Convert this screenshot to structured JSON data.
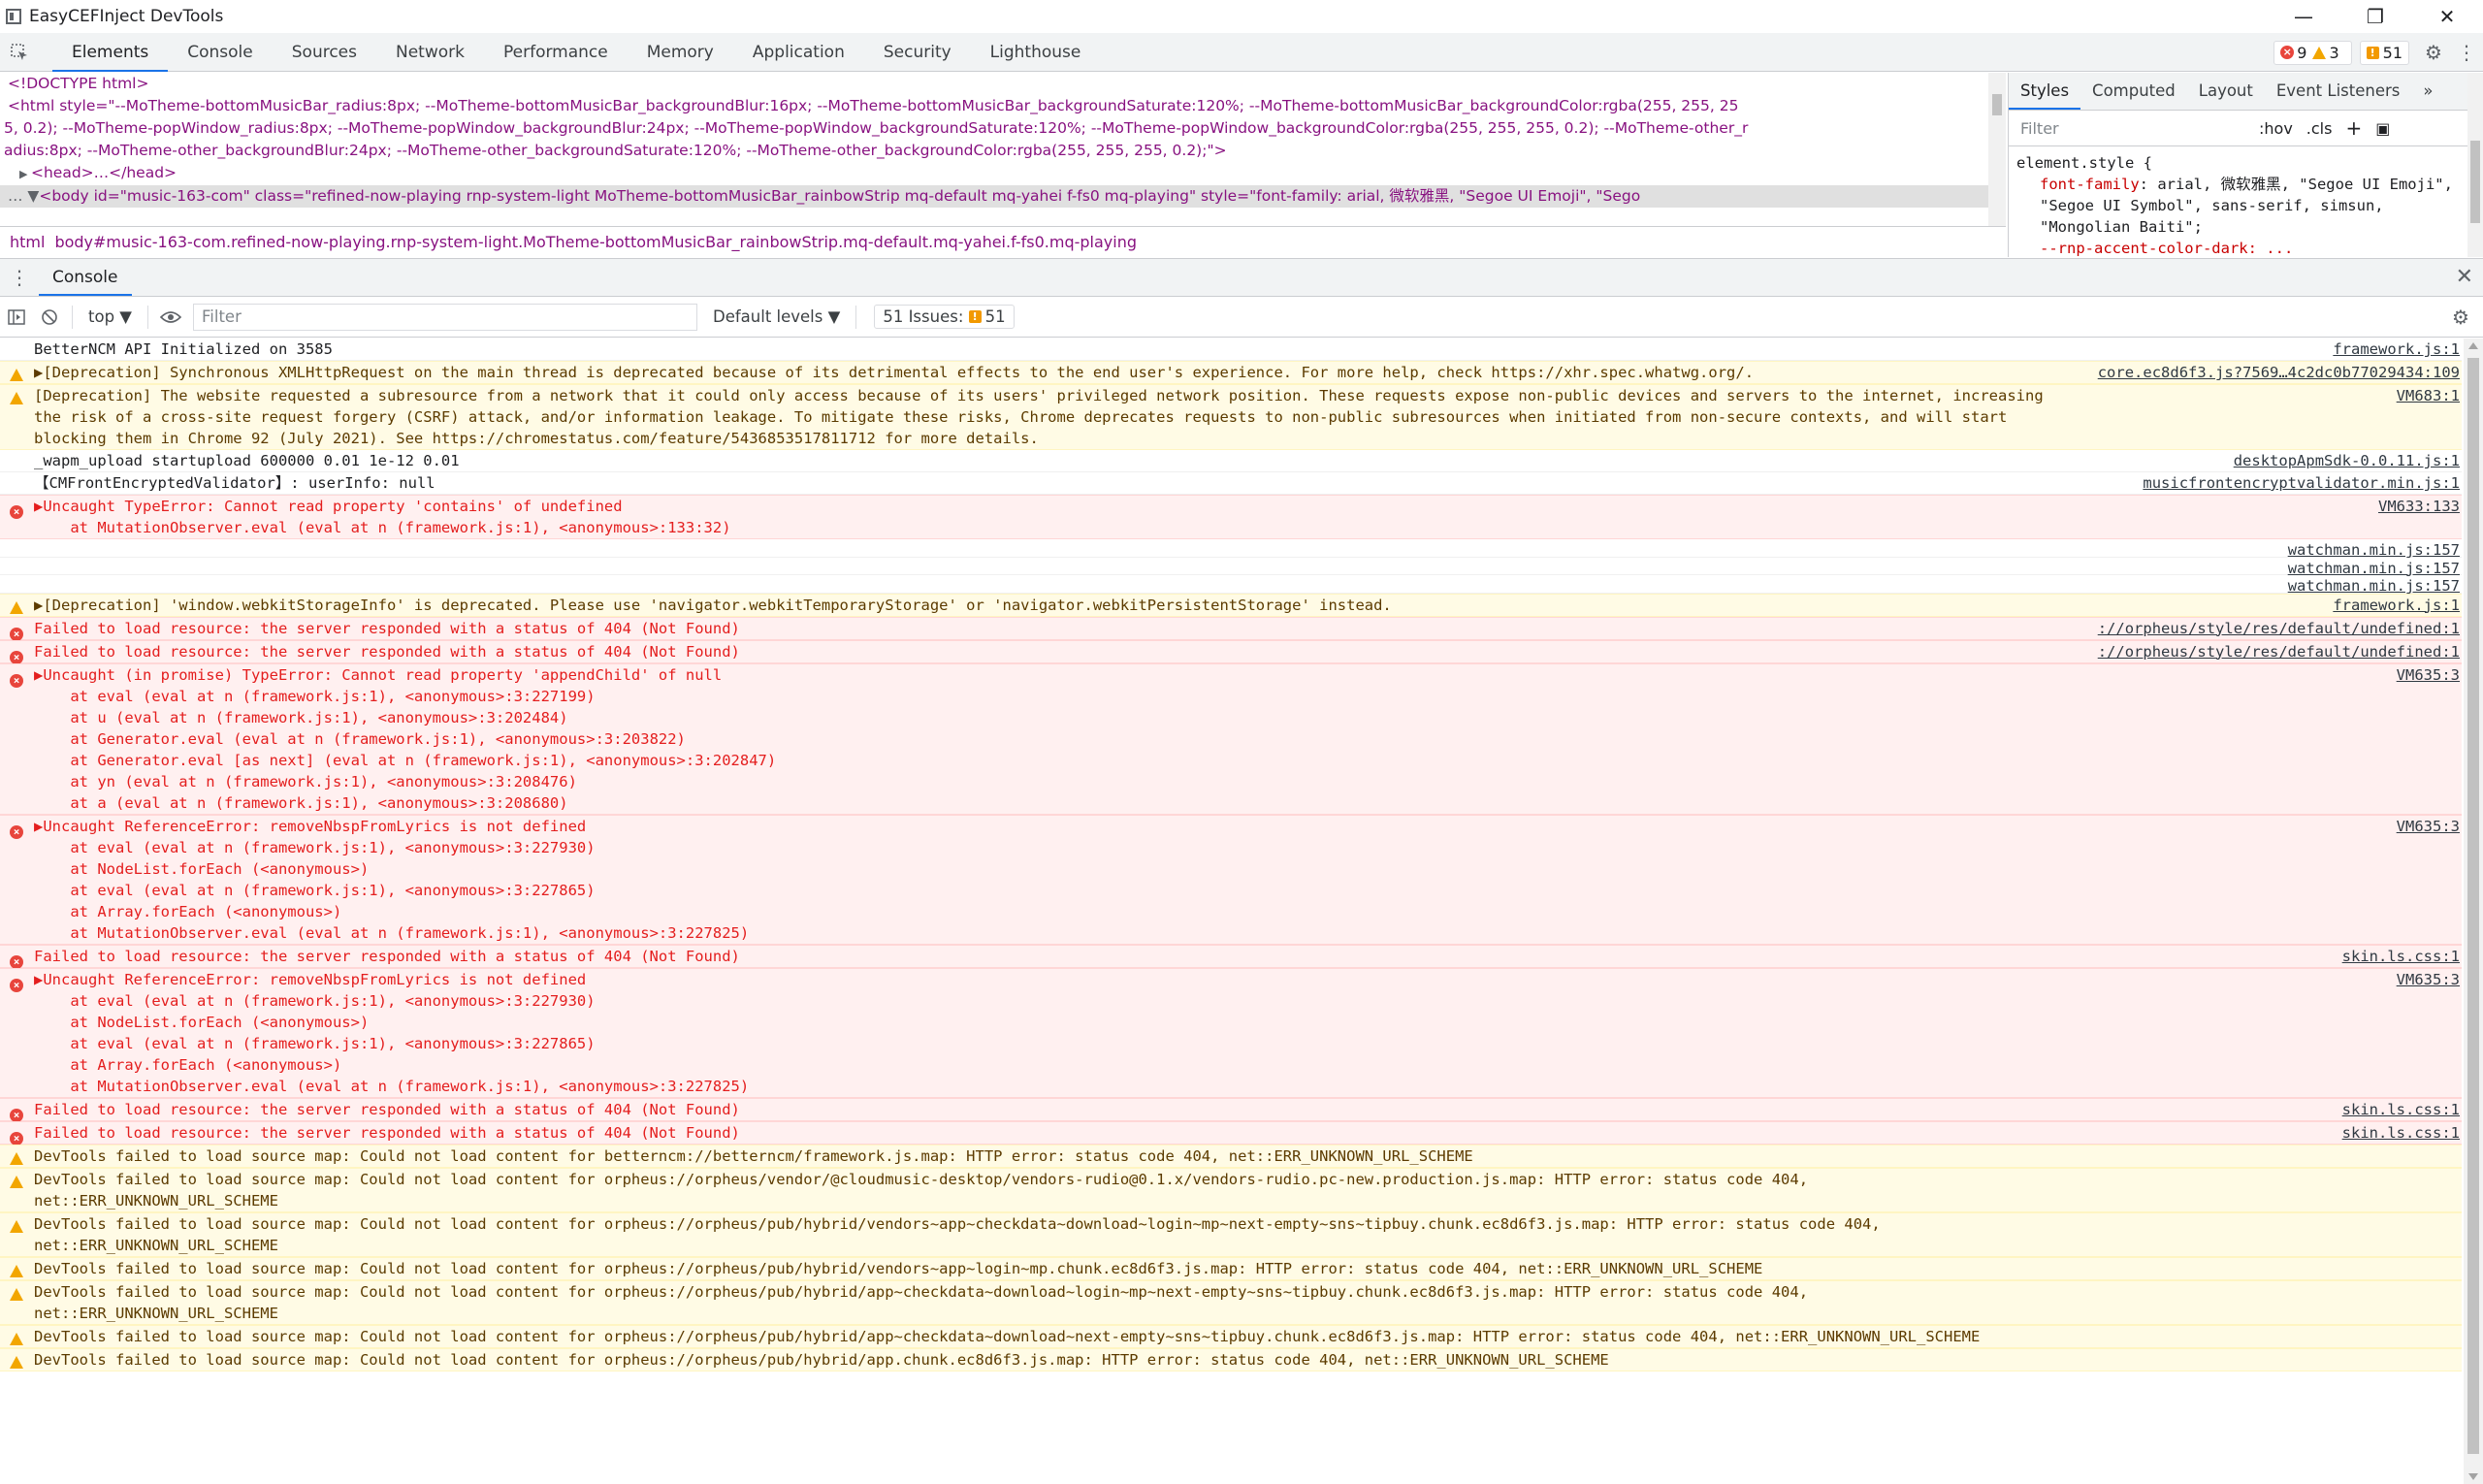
{
  "window": {
    "title": "EasyCEFInject DevTools",
    "minimize": "—",
    "restore": "❐",
    "close": "✕"
  },
  "tabs": [
    "Elements",
    "Console",
    "Sources",
    "Network",
    "Performance",
    "Memory",
    "Application",
    "Security",
    "Lighthouse"
  ],
  "counts": {
    "errors": "9",
    "warnings": "3",
    "issues": "51"
  },
  "elements": {
    "doctype": "<!DOCTYPE html>",
    "html_open": "<html style=\"--MoTheme-bottomMusicBar_radius:8px; --MoTheme-bottomMusicBar_backgroundBlur:16px; --MoTheme-bottomMusicBar_backgroundSaturate:120%; --MoTheme-bottomMusicBar_backgroundColor:rgba(255, 255, 25",
    "html_line2": "5, 0.2); --MoTheme-popWindow_radius:8px; --MoTheme-popWindow_backgroundBlur:24px; --MoTheme-popWindow_backgroundSaturate:120%; --MoTheme-popWindow_backgroundColor:rgba(255, 255, 255, 0.2); --MoTheme-other_r",
    "html_line3": "adius:8px; --MoTheme-other_backgroundBlur:24px; --MoTheme-other_backgroundSaturate:120%; --MoTheme-other_backgroundColor:rgba(255, 255, 255, 0.2);\">",
    "head": "<head>…</head>",
    "body": "<body id=\"music-163-com\" class=\"refined-now-playing rnp-system-light MoTheme-bottomMusicBar_rainbowStrip mq-default mq-yahei f-fs0 mq-playing\" style=\"font-family: arial, 微软雅黑, \"Segoe UI Emoji\", \"Sego",
    "crumb_html": "html",
    "crumb_body": "body#music-163-com.refined-now-playing.rnp-system-light.MoTheme-bottomMusicBar_rainbowStrip.mq-default.mq-yahei.f-fs0.mq-playing"
  },
  "styles": {
    "tabs": [
      "Styles",
      "Computed",
      "Layout",
      "Event Listeners"
    ],
    "more": "»",
    "filter_placeholder": "Filter",
    "hov": ":hov",
    "cls": ".cls",
    "plus": "+",
    "rule_selector": "element.style {",
    "prop_name": "font-family",
    "prop_value": ": arial, 微软雅黑, \"Segoe UI Emoji\", \"Segoe UI Symbol\", sans-serif, simsun, \"Mongolian Baiti\";",
    "next_prop": "--rnp-accent-color-dark: ..."
  },
  "drawer": {
    "tab": "Console",
    "close": "✕"
  },
  "console_toolbar": {
    "context": "top",
    "filter_placeholder": "Filter",
    "levels": "Default levels",
    "issues_label": "51 Issues:",
    "issues_count": "51"
  },
  "messages": [
    {
      "level": "info",
      "text": "BetterNCM API Initialized on 3585",
      "source": "framework.js:1"
    },
    {
      "level": "warn",
      "text": "▶[Deprecation] Synchronous XMLHttpRequest on the main thread is deprecated because of its detrimental effects to the end user's experience. For more help, check https://xhr.spec.whatwg.org/.",
      "source": "core.ec8d6f3.js?7569…4c2dc0b77029434:109"
    },
    {
      "level": "warn",
      "text": "[Deprecation] The website requested a subresource from a network that it could only access because of its users' privileged network position. These requests expose non-public devices and servers to the internet, increasing the risk of a cross-site request forgery (CSRF) attack, and/or information leakage. To mitigate these risks, Chrome deprecates requests to non-public subresources when initiated from non-secure contexts, and will start blocking them in Chrome 92 (July 2021). See https://chromestatus.com/feature/5436853517811712 for more details.",
      "source": "VM683:1"
    },
    {
      "level": "info",
      "text": "_wapm_upload startupload 600000 0.01 1e-12 0.01",
      "source": "desktopApmSdk-0.0.11.js:1"
    },
    {
      "level": "info",
      "text": "【CMFrontEncryptedValidator】: userInfo: null",
      "source": "musicfrontencryptvalidator.min.js:1"
    },
    {
      "level": "error",
      "text": "▶Uncaught TypeError: Cannot read property 'contains' of undefined\n    at MutationObserver.eval (eval at n (framework.js:1), <anonymous>:133:32)",
      "source": "VM633:133"
    },
    {
      "level": "info",
      "text": "",
      "source": "watchman.min.js:157"
    },
    {
      "level": "info",
      "text": "",
      "source": "watchman.min.js:157"
    },
    {
      "level": "info",
      "text": "",
      "source": "watchman.min.js:157"
    },
    {
      "level": "warn",
      "text": "▶[Deprecation] 'window.webkitStorageInfo' is deprecated. Please use 'navigator.webkitTemporaryStorage' or 'navigator.webkitPersistentStorage' instead.",
      "source": "framework.js:1"
    },
    {
      "level": "error",
      "text": "Failed to load resource: the server responded with a status of 404 (Not Found)",
      "source": "://orpheus/style/res/default/undefined:1"
    },
    {
      "level": "error",
      "text": "Failed to load resource: the server responded with a status of 404 (Not Found)",
      "source": "://orpheus/style/res/default/undefined:1"
    },
    {
      "level": "error",
      "text": "▶Uncaught (in promise) TypeError: Cannot read property 'appendChild' of null\n    at eval (eval at n (framework.js:1), <anonymous>:3:227199)\n    at u (eval at n (framework.js:1), <anonymous>:3:202484)\n    at Generator.eval (eval at n (framework.js:1), <anonymous>:3:203822)\n    at Generator.eval [as next] (eval at n (framework.js:1), <anonymous>:3:202847)\n    at yn (eval at n (framework.js:1), <anonymous>:3:208476)\n    at a (eval at n (framework.js:1), <anonymous>:3:208680)",
      "source": "VM635:3"
    },
    {
      "level": "error",
      "text": "▶Uncaught ReferenceError: removeNbspFromLyrics is not defined\n    at eval (eval at n (framework.js:1), <anonymous>:3:227930)\n    at NodeList.forEach (<anonymous>)\n    at eval (eval at n (framework.js:1), <anonymous>:3:227865)\n    at Array.forEach (<anonymous>)\n    at MutationObserver.eval (eval at n (framework.js:1), <anonymous>:3:227825)",
      "source": "VM635:3"
    },
    {
      "level": "error",
      "text": "Failed to load resource: the server responded with a status of 404 (Not Found)",
      "source": "skin.ls.css:1"
    },
    {
      "level": "error",
      "text": "▶Uncaught ReferenceError: removeNbspFromLyrics is not defined\n    at eval (eval at n (framework.js:1), <anonymous>:3:227930)\n    at NodeList.forEach (<anonymous>)\n    at eval (eval at n (framework.js:1), <anonymous>:3:227865)\n    at Array.forEach (<anonymous>)\n    at MutationObserver.eval (eval at n (framework.js:1), <anonymous>:3:227825)",
      "source": "VM635:3"
    },
    {
      "level": "error",
      "text": "Failed to load resource: the server responded with a status of 404 (Not Found)",
      "source": "skin.ls.css:1"
    },
    {
      "level": "error",
      "text": "Failed to load resource: the server responded with a status of 404 (Not Found)",
      "source": "skin.ls.css:1"
    },
    {
      "level": "warn",
      "text": "DevTools failed to load source map: Could not load content for betterncm://betterncm/framework.js.map: HTTP error: status code 404, net::ERR_UNKNOWN_URL_SCHEME",
      "source": ""
    },
    {
      "level": "warn",
      "text": "DevTools failed to load source map: Could not load content for orpheus://orpheus/vendor/@cloudmusic-desktop/vendors-rudio@0.1.x/vendors-rudio.pc-new.production.js.map: HTTP error: status code 404, net::ERR_UNKNOWN_URL_SCHEME",
      "source": ""
    },
    {
      "level": "warn",
      "text": "DevTools failed to load source map: Could not load content for orpheus://orpheus/pub/hybrid/vendors~app~checkdata~download~login~mp~next-empty~sns~tipbuy.chunk.ec8d6f3.js.map: HTTP error: status code 404, net::ERR_UNKNOWN_URL_SCHEME",
      "source": ""
    },
    {
      "level": "warn",
      "text": "DevTools failed to load source map: Could not load content for orpheus://orpheus/pub/hybrid/vendors~app~login~mp.chunk.ec8d6f3.js.map: HTTP error: status code 404, net::ERR_UNKNOWN_URL_SCHEME",
      "source": ""
    },
    {
      "level": "warn",
      "text": "DevTools failed to load source map: Could not load content for orpheus://orpheus/pub/hybrid/app~checkdata~download~login~mp~next-empty~sns~tipbuy.chunk.ec8d6f3.js.map: HTTP error: status code 404, net::ERR_UNKNOWN_URL_SCHEME",
      "source": ""
    },
    {
      "level": "warn",
      "text": "DevTools failed to load source map: Could not load content for orpheus://orpheus/pub/hybrid/app~checkdata~download~next-empty~sns~tipbuy.chunk.ec8d6f3.js.map: HTTP error: status code 404, net::ERR_UNKNOWN_URL_SCHEME",
      "source": ""
    },
    {
      "level": "warn",
      "text": "DevTools failed to load source map: Could not load content for orpheus://orpheus/pub/hybrid/app.chunk.ec8d6f3.js.map: HTTP error: status code 404, net::ERR_UNKNOWN_URL_SCHEME",
      "source": ""
    }
  ]
}
